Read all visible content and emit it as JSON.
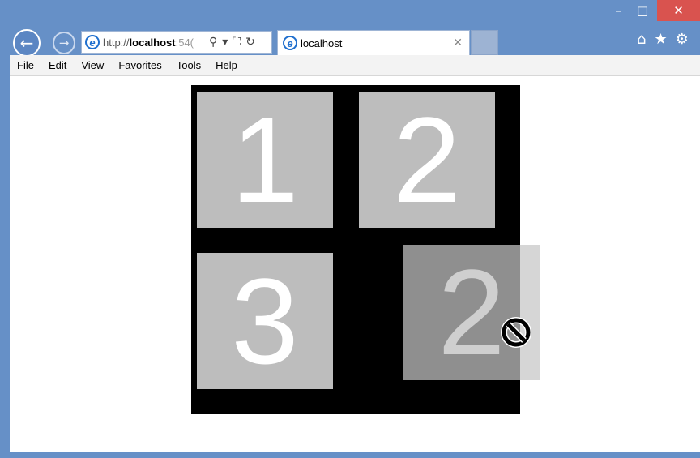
{
  "window": {
    "minimize_glyph": "–",
    "maximize_glyph": "□",
    "close_glyph": "✕"
  },
  "nav": {
    "back_glyph": "←",
    "forward_glyph": "→"
  },
  "address": {
    "protocol": "http://",
    "host": "localhost",
    "rest": ":54(",
    "search_glyph": "⚲",
    "dropdown_glyph": "▾",
    "compat_glyph": "⛶",
    "refresh_glyph": "↻"
  },
  "tab": {
    "title": "localhost",
    "close_glyph": "✕"
  },
  "toolbar": {
    "home_glyph": "⌂",
    "favorites_glyph": "★",
    "settings_glyph": "⚙"
  },
  "menu": [
    "File",
    "Edit",
    "View",
    "Favorites",
    "Tools",
    "Help"
  ],
  "board": {
    "tiles": [
      "1",
      "2",
      "3"
    ],
    "dragged_tile": "2"
  },
  "colors": {
    "frame": "#6690c7",
    "board": "#000000",
    "tile": "#bdbdbd",
    "close_button": "#d9534f"
  },
  "icons": {
    "ie": "ie-logo-icon",
    "cursor": "no-drop-cursor-icon"
  }
}
